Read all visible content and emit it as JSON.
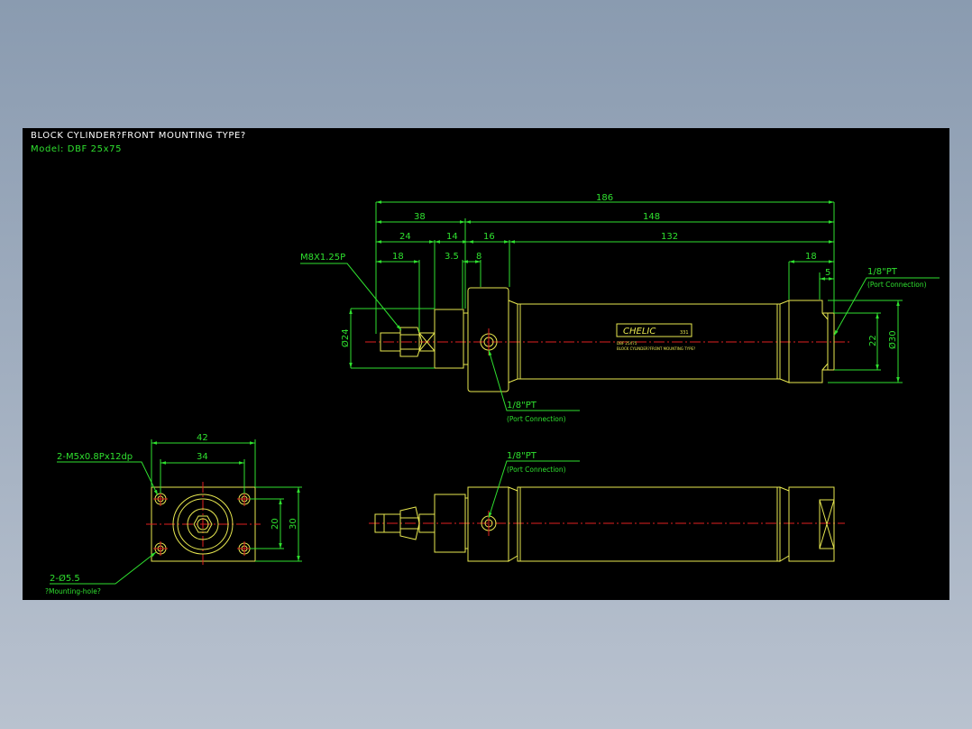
{
  "header": {
    "title": "BLOCK CYLINDER?FRONT MOUNTING TYPE?",
    "model": "Model: DBF 25x75"
  },
  "dims": {
    "overall": "186",
    "d38": "38",
    "d148": "148",
    "d24": "24",
    "d14": "14",
    "d16": "16",
    "d132": "132",
    "d18a": "18",
    "d3_5": "3.5",
    "d8": "8",
    "d18b": "18",
    "d5": "5",
    "phi24": "Ø24",
    "d22": "22",
    "phi30": "Ø30",
    "end_w42": "42",
    "end_w34": "34",
    "end_h20": "20",
    "end_h30": "30"
  },
  "callouts": {
    "thread": "M8X1.25P",
    "port_right": "1/8\"PT",
    "port_right_sub": "(Port Connection)",
    "port_mid": "1/8\"PT",
    "port_mid_sub": "(Port Connection)",
    "port_low": "1/8\"PT",
    "port_low_sub": "(Port Connection)",
    "screw": "2-M5x0.8Px12dp",
    "hole": "2-Ø5.5",
    "hole_sub": "?Mounting-hole?"
  },
  "label_plate": {
    "brand": "CHELIC",
    "code": "331",
    "line1": "DBF 25X75",
    "line2": "BLOCK CYLINDER?FRONT MOUNTING TYPE?"
  },
  "colors": {
    "background": "#000000",
    "dimension": "#2fe02f",
    "geometry": "#e8e850",
    "centerline": "#e02020",
    "title": "#ffffff"
  }
}
